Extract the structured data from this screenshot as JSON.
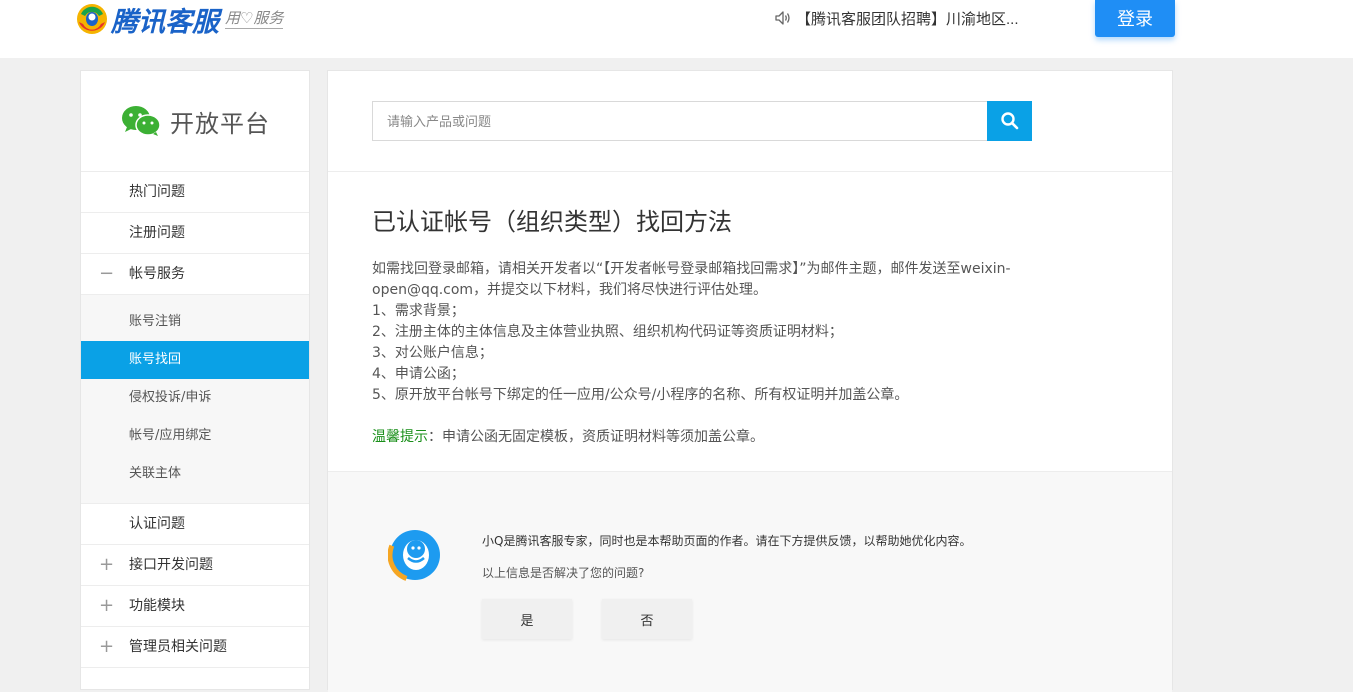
{
  "header": {
    "logo_text": "腾讯客服",
    "slogan": "用♡服务",
    "notice": "【腾讯客服团队招聘】川渝地区...",
    "login_label": "登录"
  },
  "sidebar": {
    "brand": "开放平台",
    "items": [
      {
        "label": "热门问题",
        "sign": ""
      },
      {
        "label": "注册问题",
        "sign": ""
      },
      {
        "label": "帐号服务",
        "sign": "−"
      },
      {
        "label": "认证问题",
        "sign": ""
      },
      {
        "label": "接口开发问题",
        "sign": "+"
      },
      {
        "label": "功能模块",
        "sign": "+"
      },
      {
        "label": "管理员相关问题",
        "sign": "+"
      }
    ],
    "sub_items": [
      {
        "label": "账号注销"
      },
      {
        "label": "账号找回"
      },
      {
        "label": "侵权投诉/申诉"
      },
      {
        "label": "帐号/应用绑定"
      },
      {
        "label": "关联主体"
      }
    ]
  },
  "search": {
    "placeholder": "请输入产品或问题"
  },
  "article": {
    "title": "已认证帐号（组织类型）找回方法",
    "intro": "如需找回登录邮箱，请相关开发者以“【开发者帐号登录邮箱找回需求】”为邮件主题，邮件发送至weixin-open@qq.com，并提交以下材料，我们将尽快进行评估处理。",
    "steps": [
      "1、需求背景；",
      "2、注册主体的主体信息及主体营业执照、组织机构代码证等资质证明材料；",
      "3、对公账户信息；",
      "4、申请公函；",
      "5、原开放平台帐号下绑定的任一应用/公众号/小程序的名称、所有权证明并加盖公章。"
    ],
    "tip_label": "温馨提示",
    "tip_text": "：申请公函无固定模板，资质证明材料等须加盖公章。"
  },
  "feedback": {
    "intro": "小Q是腾讯客服专家，同时也是本帮助页面的作者。请在下方提供反馈，以帮助她优化内容。",
    "question": "以上信息是否解决了您的问题?",
    "yes_label": "是",
    "no_label": "否"
  },
  "colors": {
    "accent": "#0aa1e6",
    "login": "#1f8ef5",
    "tip": "#1a8f1a"
  }
}
